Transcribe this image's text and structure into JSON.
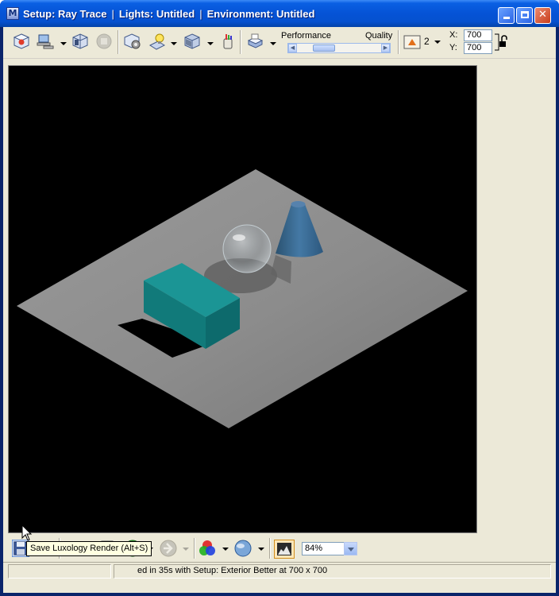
{
  "window": {
    "title_parts": [
      "Setup: Ray Trace",
      "Lights: Untitled",
      "Environment: Untitled"
    ],
    "app_icon_glyph": "M"
  },
  "toolbar": {
    "performance_label": "Performance",
    "quality_label": "Quality",
    "performance_quality_level": 0.25,
    "antialias_value": "2",
    "x_label": "X:",
    "x_value": "700",
    "y_label": "Y:",
    "y_value": "700",
    "icons": [
      "render-icon",
      "network-render-icon",
      "render-settings-icon",
      "stop-render-icon",
      "setup-icon",
      "lights-icon",
      "environment-icon",
      "paint-icon",
      "printer-icon",
      "antialias-icon",
      "lock-aspect-icon"
    ]
  },
  "bottombar": {
    "zoom_value": "84%",
    "icons": [
      "save-render-icon",
      "copy-render-icon",
      "open-folder-icon",
      "delete-render-icon",
      "back-arrow-icon",
      "forward-arrow-icon",
      "color-channels-icon",
      "globe-icon",
      "histogram-icon"
    ]
  },
  "statusbar": {
    "text": "ed in 35s with Setup: Exterior Better at 700 x 700"
  },
  "tooltip": {
    "text": "Save Luxology Render (Alt+S)"
  },
  "colors": {
    "titlebar": "#0553d6",
    "client": "#ece9d8",
    "viewport": "#000000",
    "floor": "#8f8f8f",
    "box": "#1a8a8a",
    "cone": "#3c6a92"
  }
}
